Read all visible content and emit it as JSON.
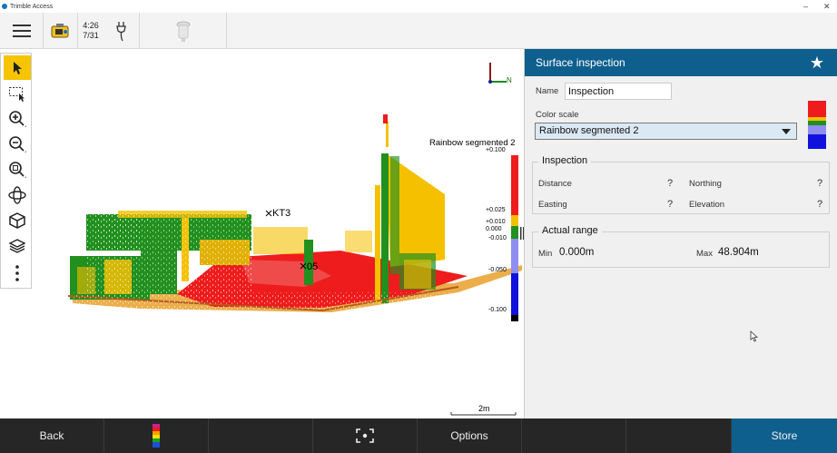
{
  "titlebar": {
    "app_title": "Trimble Access",
    "minimize": "–",
    "restore": "▫",
    "close": "✕"
  },
  "toolbar": {
    "time": "4:26",
    "date": "7/31"
  },
  "map": {
    "labels": {
      "point_a": "KT3",
      "point_b": "05",
      "scale_bar": "2m",
      "north": "N"
    },
    "legend": {
      "title": "Rainbow segmented 2",
      "ticks": [
        "+0.100",
        "+0.025",
        "+0.010",
        "0.000",
        "-0.010",
        "-0.050",
        "-0.100"
      ],
      "colors": {
        "red": "#ee1c1c",
        "yellow": "#f5c000",
        "green": "#21901e",
        "lavender": "#8e8ef0",
        "blue": "#1111dd",
        "black": "#000000"
      }
    }
  },
  "panel": {
    "title": "Surface inspection",
    "name_label": "Name",
    "name_value": "Inspection",
    "color_scale_label": "Color scale",
    "color_scale_value": "Rainbow segmented 2",
    "inspection": {
      "title": "Inspection",
      "distance_label": "Distance",
      "distance_value": "?",
      "northing_label": "Northing",
      "northing_value": "?",
      "easting_label": "Easting",
      "easting_value": "?",
      "elevation_label": "Elevation",
      "elevation_value": "?"
    },
    "actual_range": {
      "title": "Actual range",
      "min_label": "Min",
      "min_value": "0.000m",
      "max_label": "Max",
      "max_value": "48.904m"
    }
  },
  "bottom": {
    "back": "Back",
    "options": "Options",
    "store": "Store"
  },
  "colors": {
    "accent": "#0f5f8e",
    "active_tool": "#f6c400",
    "bottom_bar": "#262626"
  }
}
